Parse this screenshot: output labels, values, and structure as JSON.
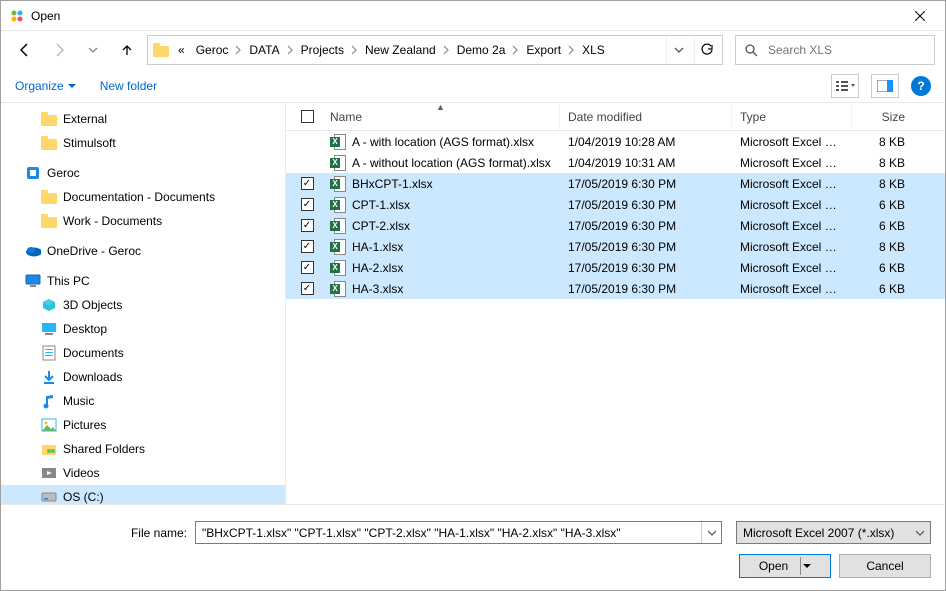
{
  "window": {
    "title": "Open"
  },
  "breadcrumbs": {
    "prefix": "«",
    "items": [
      "Geroc",
      "DATA",
      "Projects",
      "New Zealand",
      "Demo 2a",
      "Export",
      "XLS"
    ]
  },
  "search": {
    "placeholder": "Search XLS"
  },
  "toolbar": {
    "organize": "Organize",
    "new_folder": "New folder"
  },
  "sidebar": [
    {
      "icon": "folder",
      "label": "External",
      "level": 1
    },
    {
      "icon": "folder",
      "label": "Stimulsoft",
      "level": 1
    },
    {
      "icon": "app",
      "label": "Geroc",
      "level": 0,
      "spacer": true
    },
    {
      "icon": "folder",
      "label": "Documentation - Documents",
      "level": 1
    },
    {
      "icon": "folder",
      "label": "Work - Documents",
      "level": 1
    },
    {
      "icon": "onedrive",
      "label": "OneDrive - Geroc",
      "level": 0,
      "spacer": true
    },
    {
      "icon": "thispc",
      "label": "This PC",
      "level": 0,
      "spacer": true
    },
    {
      "icon": "3d",
      "label": "3D Objects",
      "level": 1
    },
    {
      "icon": "desktop",
      "label": "Desktop",
      "level": 1
    },
    {
      "icon": "documents",
      "label": "Documents",
      "level": 1
    },
    {
      "icon": "downloads",
      "label": "Downloads",
      "level": 1
    },
    {
      "icon": "music",
      "label": "Music",
      "level": 1
    },
    {
      "icon": "pictures",
      "label": "Pictures",
      "level": 1
    },
    {
      "icon": "shared",
      "label": "Shared Folders",
      "level": 1
    },
    {
      "icon": "videos",
      "label": "Videos",
      "level": 1
    },
    {
      "icon": "drive",
      "label": "OS (C:)",
      "level": 1,
      "selected": true
    }
  ],
  "columns": {
    "name": "Name",
    "date": "Date modified",
    "type": "Type",
    "size": "Size"
  },
  "files": [
    {
      "name": "A - with location (AGS format).xlsx",
      "date": "1/04/2019 10:28 AM",
      "type": "Microsoft Excel W...",
      "size": "8 KB",
      "selected": false
    },
    {
      "name": "A - without location (AGS format).xlsx",
      "date": "1/04/2019 10:31 AM",
      "type": "Microsoft Excel W...",
      "size": "8 KB",
      "selected": false
    },
    {
      "name": "BHxCPT-1.xlsx",
      "date": "17/05/2019 6:30 PM",
      "type": "Microsoft Excel W...",
      "size": "8 KB",
      "selected": true
    },
    {
      "name": "CPT-1.xlsx",
      "date": "17/05/2019 6:30 PM",
      "type": "Microsoft Excel W...",
      "size": "6 KB",
      "selected": true
    },
    {
      "name": "CPT-2.xlsx",
      "date": "17/05/2019 6:30 PM",
      "type": "Microsoft Excel W...",
      "size": "6 KB",
      "selected": true
    },
    {
      "name": "HA-1.xlsx",
      "date": "17/05/2019 6:30 PM",
      "type": "Microsoft Excel W...",
      "size": "8 KB",
      "selected": true
    },
    {
      "name": "HA-2.xlsx",
      "date": "17/05/2019 6:30 PM",
      "type": "Microsoft Excel W...",
      "size": "6 KB",
      "selected": true
    },
    {
      "name": "HA-3.xlsx",
      "date": "17/05/2019 6:30 PM",
      "type": "Microsoft Excel W...",
      "size": "6 KB",
      "selected": true
    }
  ],
  "filename": {
    "label": "File name:",
    "value": "\"BHxCPT-1.xlsx\" \"CPT-1.xlsx\" \"CPT-2.xlsx\" \"HA-1.xlsx\" \"HA-2.xlsx\" \"HA-3.xlsx\""
  },
  "filetype": {
    "value": "Microsoft Excel 2007 (*.xlsx)"
  },
  "buttons": {
    "open": "Open",
    "cancel": "Cancel"
  },
  "help": "?"
}
